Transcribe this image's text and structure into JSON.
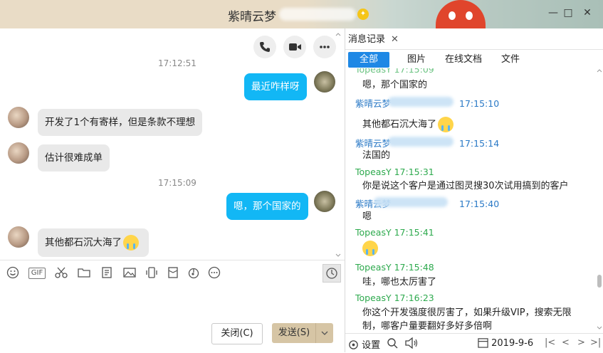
{
  "window": {
    "title": "紫晴云梦",
    "title_suffix_blurred": "_____",
    "minimize": "—",
    "maximize": "□",
    "close": "✕"
  },
  "chat": {
    "actions": [
      "phone-call",
      "video-call",
      "more"
    ],
    "messages": [
      {
        "type": "time",
        "text": "17:12:51"
      },
      {
        "type": "out",
        "text": "最近咋样呀"
      },
      {
        "type": "in",
        "text": "开发了1个有寄样，但是条款不理想"
      },
      {
        "type": "in",
        "text": "估计很难成单"
      },
      {
        "type": "time",
        "text": "17:15:09"
      },
      {
        "type": "out",
        "text": "嗯，那个国家的"
      },
      {
        "type": "in",
        "text": "其他都石沉大海了"
      }
    ]
  },
  "toolbar": {
    "icons": [
      "emoji-icon",
      "gif-icon",
      "screenshot-scissors-icon",
      "folder-icon",
      "doc-icon",
      "image-icon",
      "shake-icon",
      "red-envelope-icon",
      "music-icon",
      "more-icon",
      "history-clock-icon"
    ],
    "gif_label": "GIF"
  },
  "buttons": {
    "close": "关闭(C)",
    "send": "发送(S)"
  },
  "history": {
    "tab_label": "消息记录",
    "filters": [
      "全部",
      "图片",
      "在线文档",
      "文件"
    ],
    "entries": [
      {
        "sender": "TopeasY",
        "time": "17:15:09",
        "msg": "嗯，那个国家的",
        "side": "me"
      },
      {
        "sender": "紫晴云梦",
        "time": "17:15:10",
        "msg": "其他都石沉大海了",
        "side": "other"
      },
      {
        "sender": "紫晴云梦",
        "time": "17:15:14",
        "msg": "法国的",
        "side": "other"
      },
      {
        "sender": "TopeasY",
        "time": "17:15:31",
        "msg": "你是说这个客户是通过图灵搜30次试用搞到的客户",
        "side": "me"
      },
      {
        "sender": "紫晴云梦",
        "time": "17:15:40",
        "msg": "嗯",
        "side": "other"
      },
      {
        "sender": "TopeasY",
        "time": "17:15:41",
        "msg": "",
        "side": "me"
      },
      {
        "sender": "TopeasY",
        "time": "17:15:48",
        "msg": "哇，哪也太厉害了",
        "side": "me"
      },
      {
        "sender": "TopeasY",
        "time": "17:16:23",
        "msg": "你这个开发强度很厉害了，如果升级VIP，搜索无限",
        "side": "me"
      }
    ],
    "last_line": "制，哪客户量要翻好多好多倍啊",
    "footer": {
      "settings": "设置",
      "date": "2019-9-6"
    }
  }
}
